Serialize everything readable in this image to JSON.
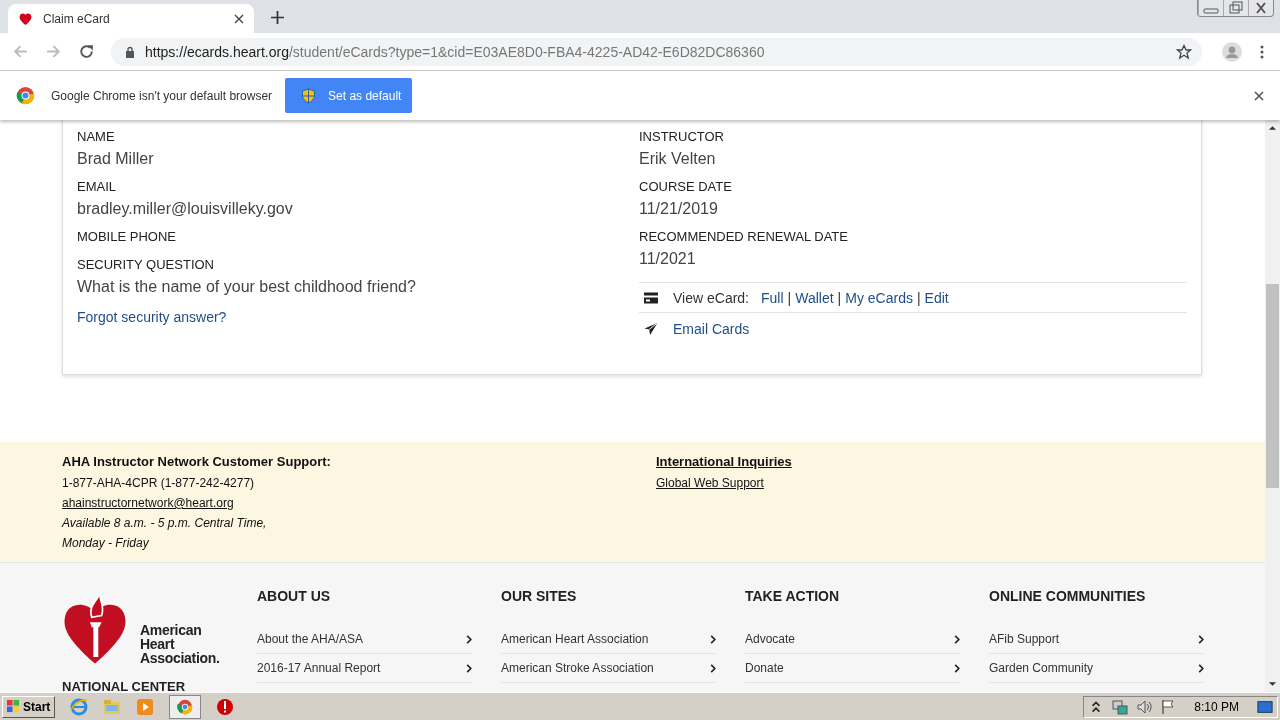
{
  "browser": {
    "tab_title": "Claim eCard",
    "url_host": "https://ecards.heart.org",
    "url_path": "/student/eCards?type=1&cid=E03AE8D0-FBA4-4225-AD42-E6D82DC86360",
    "infobar_text": "Google Chrome isn't your default browser",
    "infobar_button": "Set as default"
  },
  "card": {
    "left_fields": [
      {
        "label": "NAME",
        "value": "Brad Miller"
      },
      {
        "label": "EMAIL",
        "value": "bradley.miller@louisvilleky.gov"
      },
      {
        "label": "MOBILE PHONE"
      },
      {
        "label": "SECURITY QUESTION",
        "value": "What is the name of your best childhood friend?"
      }
    ],
    "forgot_link": "Forgot security answer?",
    "right_fields": [
      {
        "label": "INSTRUCTOR",
        "value": "Erik Velten"
      },
      {
        "label": "COURSE DATE",
        "value": "11/21/2019"
      },
      {
        "label": "RECOMMENDED RENEWAL DATE",
        "value": "11/2021"
      }
    ],
    "view_label": "View eCard:",
    "view_items": [
      {
        "kind": "link",
        "text": "Full"
      },
      {
        "kind": "separator",
        "text": "|"
      },
      {
        "kind": "link",
        "text": "Wallet"
      },
      {
        "kind": "separator",
        "text": "|"
      },
      {
        "kind": "link",
        "text": "My eCards"
      },
      {
        "kind": "separator",
        "text": "|"
      },
      {
        "kind": "link",
        "text": "Edit"
      }
    ],
    "email_link": "Email Cards"
  },
  "support": {
    "title": "AHA Instructor Network Customer Support:",
    "phone": "1-877-AHA-4CPR (1-877-242-4277)",
    "email": "ahainstructornetwork@heart.org",
    "hours": [
      "Available 8 a.m. - 5 p.m. Central Time,",
      "Monday - Friday"
    ],
    "intl_title": "International Inquiries",
    "intl_link": "Global Web Support"
  },
  "footer": {
    "logo_text": [
      "American",
      "Heart",
      "Association."
    ],
    "center_title": "NATIONAL CENTER",
    "columns": [
      {
        "title": "ABOUT US",
        "links": [
          "About the AHA/ASA",
          "2016-17 Annual Report"
        ]
      },
      {
        "title": "OUR SITES",
        "links": [
          "American Heart Association",
          "American Stroke Association"
        ]
      },
      {
        "title": "TAKE ACTION",
        "links": [
          "Advocate",
          "Donate"
        ]
      },
      {
        "title": "ONLINE COMMUNITIES",
        "links": [
          "AFib Support",
          "Garden Community"
        ]
      }
    ]
  },
  "taskbar": {
    "start": "Start",
    "clock": "8:10 PM"
  }
}
